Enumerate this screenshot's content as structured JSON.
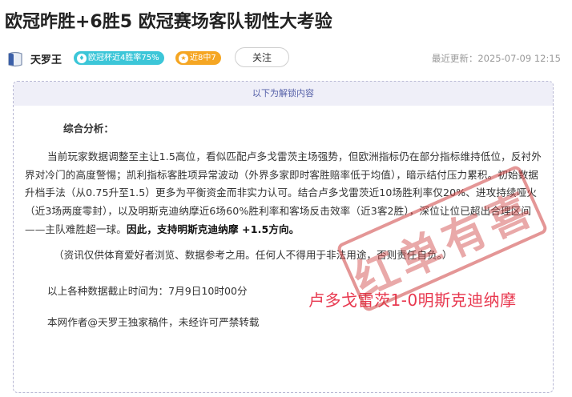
{
  "article": {
    "title": "欧冠昨胜+6胜5 欧冠赛场客队韧性大考验"
  },
  "author": {
    "name": "天罗王",
    "badge_1": "欧冠杯近4胜率75%",
    "badge_2": "近8中7",
    "follow_label": "关注",
    "last_updated": "最近更新：2025-07-09 12:15"
  },
  "locked": {
    "banner": "以下为解锁内容",
    "section_heading": "综合分析：",
    "paragraph": "当前玩家数据调整至主让1.5高位，看似匹配卢多戈雷茨主场强势，但欧洲指标仍在部分指标维持低位，反衬外界对冷门的高度警惕；凯利指标客胜项异常波动（外界多家即时客胜赔率低于均值），暗示结付压力累积。初始数据升档手法（从0.75升至1.5）更多为平衡资金而非实力认可。结合卢多戈雷茨近10场胜利率仅20%、进攻持续哑火（近3场两度零封），以及明斯克迪纳摩近6场60%胜利率和客场反击效率（近3客2胜），深位让位已超出合理区间——主队难胜超一球。",
    "paragraph_bold": "因此，支持明斯克迪纳摩 +1.5方向。",
    "disclaimer": "（资讯仅供体育爱好者浏览、数据参考之用。任何人不得用于非法用途，否则责任自负。）",
    "cutoff": "以上各种数据截止时间为：7月9日10时00分",
    "copyright": "本网作者@天罗王独家稿件，未经许可严禁转载",
    "prediction": "卢多戈雷茨1-0明斯克迪纳摩",
    "stamp_text": "红单有喜"
  },
  "colors": {
    "accent_red": "#e8384f",
    "badge_teal": "#3cc6d8",
    "badge_orange": "#f5a623",
    "banner_text": "#5560a8"
  },
  "icons": {
    "avatar": "avatar-icon",
    "badge_1": "trophy-icon",
    "badge_2": "star-icon"
  }
}
